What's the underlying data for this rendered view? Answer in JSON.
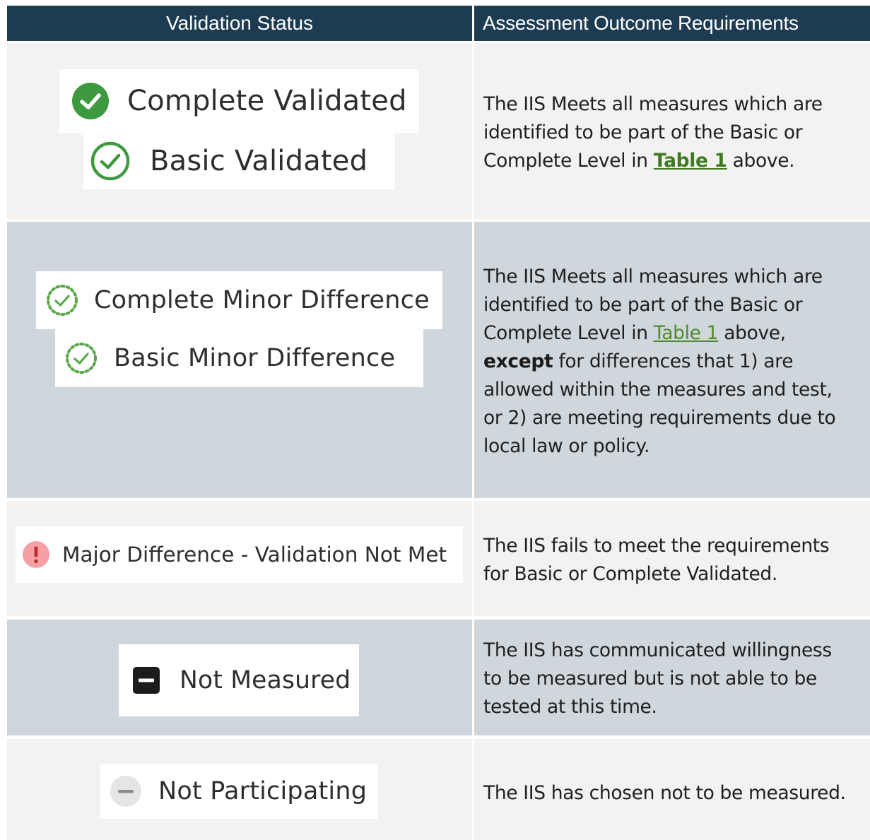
{
  "table": {
    "headers": {
      "status": "Validation Status",
      "requirements": "Assessment Outcome Requirements"
    },
    "rows": [
      {
        "badges": [
          {
            "label": "Complete Validated",
            "icon": "check-circle-filled-icon"
          },
          {
            "label": "Basic Validated",
            "icon": "check-circle-outline-icon"
          }
        ],
        "requirement": {
          "line1": "The IIS Meets all measures which are",
          "line2": "identified to be part of the Basic or",
          "line3_pre": "Complete Level in ",
          "link": "Table 1",
          "line3_post": " above."
        }
      },
      {
        "badges": [
          {
            "label": "Complete Minor Difference",
            "icon": "check-circle-dashed-icon"
          },
          {
            "label": "Basic Minor Difference",
            "icon": "check-circle-dashed-icon"
          }
        ],
        "requirement": {
          "line1": "The IIS Meets all measures which are",
          "line2": "identified to be part of the Basic or",
          "line3_pre": "Complete Level in ",
          "link": "Table 1",
          "line3_post": " above,",
          "line4_bold": "except",
          "line4_rest": " for differences that 1) are",
          "line5": "allowed within the measures and test,",
          "line6": "or 2) are meeting requirements due to",
          "line7": "local law or policy."
        }
      },
      {
        "badges": [
          {
            "label": "Major Difference - Validation Not Met",
            "icon": "exclamation-circle-icon"
          }
        ],
        "requirement": {
          "line1": "The IIS fails to meet the requirements",
          "line2": "for Basic or Complete Validated."
        }
      },
      {
        "badges": [
          {
            "label": "Not Measured",
            "icon": "minus-square-icon"
          }
        ],
        "requirement": {
          "line1": "The IIS has communicated willingness",
          "line2": "to be measured but is not able to be",
          "line3": "tested at this time."
        }
      },
      {
        "badges": [
          {
            "label": "Not Participating",
            "icon": "minus-circle-icon"
          }
        ],
        "requirement": {
          "line1": "The IIS has chosen not to be measured."
        }
      }
    ]
  },
  "colors": {
    "header_bg": "#1d3c52",
    "row_light": "#f2f2f2",
    "row_dark": "#cfd6dc",
    "validated_green": "#3e9a3e",
    "link_green": "#4e8a2c",
    "dashed_green": "#5aa84a",
    "alert_pink": "#f4a0a4",
    "alert_red": "#c0282f"
  }
}
